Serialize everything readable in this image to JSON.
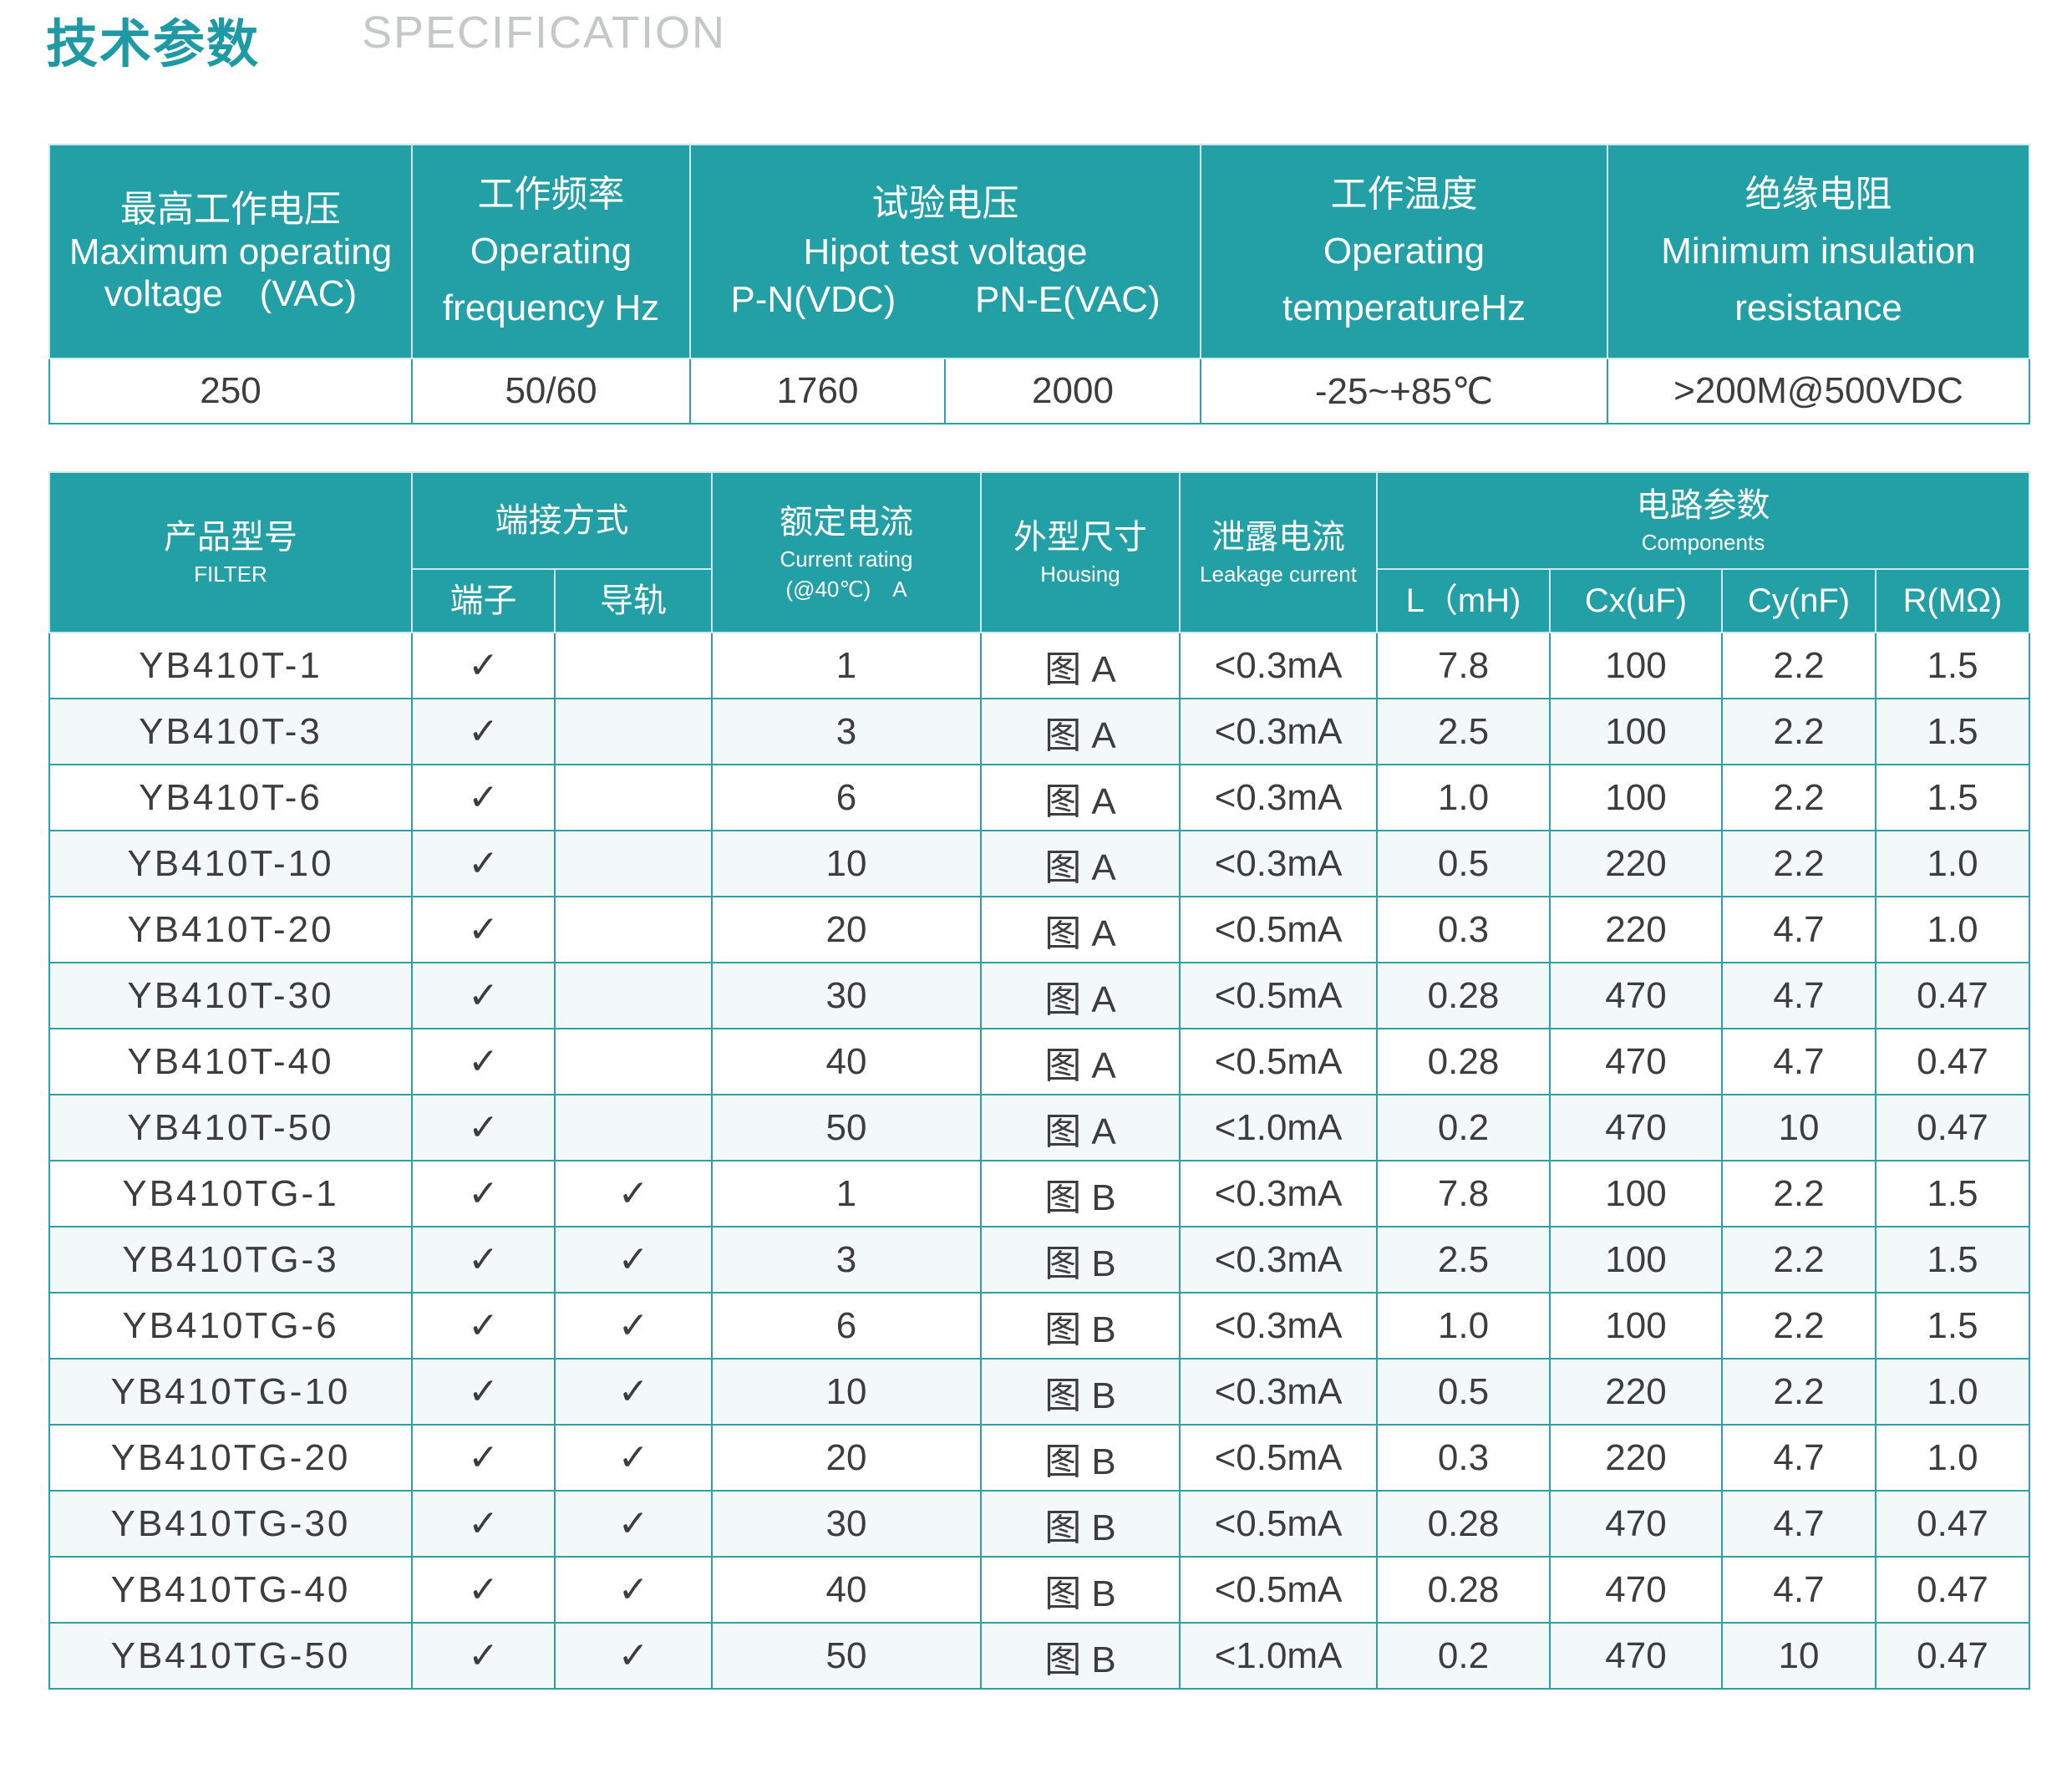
{
  "header": {
    "title_cn": "技术参数",
    "title_en": "SPECIFICATION"
  },
  "spec": {
    "headers": {
      "max_voltage_cn": "最高工作电压",
      "max_voltage_en": "Maximum operating",
      "max_voltage_en2": "voltage　(VAC)",
      "freq_cn": "工作频率",
      "freq_en": "Operating",
      "freq_en2": "frequency Hz",
      "hipot_cn": "试验电压",
      "hipot_en": "Hipot test voltage",
      "hipot_pn": "P-N(VDC)",
      "hipot_pne": "PN-E(VAC)",
      "temp_cn": "工作温度",
      "temp_en": "Operating",
      "temp_en2": "temperatureHz",
      "ins_cn": "绝缘电阻",
      "ins_en": "Minimum insulation",
      "ins_en2": "resistance"
    },
    "values": [
      "250",
      "50/60",
      "1760",
      "2000",
      "-25~+85℃",
      ">200M@500VDC"
    ]
  },
  "models": {
    "headers": {
      "product_cn": "产品型号",
      "product_en": "FILTER",
      "term_cn": "端接方式",
      "terminal": "端子",
      "rail": "导轨",
      "current_cn": "额定电流",
      "current_en": "Current rating",
      "current_unit": "(@40℃)　A",
      "housing_cn": "外型尺寸",
      "housing_en": "Housing",
      "leak_cn": "泄露电流",
      "leak_en": "Leakage current",
      "circuit_cn": "电路参数",
      "circuit_en": "Components",
      "l": "L（mH)",
      "cx": "Cx(uF)",
      "cy": "Cy(nF)",
      "r": "R(MΩ)"
    },
    "rows": [
      {
        "model": "YB410T-1",
        "terminal": "✓",
        "rail": "",
        "current": "1",
        "housing": "图 A",
        "leak": "<0.3mA",
        "l": "7.8",
        "cx": "100",
        "cy": "2.2",
        "r": "1.5"
      },
      {
        "model": "YB410T-3",
        "terminal": "✓",
        "rail": "",
        "current": "3",
        "housing": "图 A",
        "leak": "<0.3mA",
        "l": "2.5",
        "cx": "100",
        "cy": "2.2",
        "r": "1.5"
      },
      {
        "model": "YB410T-6",
        "terminal": "✓",
        "rail": "",
        "current": "6",
        "housing": "图 A",
        "leak": "<0.3mA",
        "l": "1.0",
        "cx": "100",
        "cy": "2.2",
        "r": "1.5"
      },
      {
        "model": "YB410T-10",
        "terminal": "✓",
        "rail": "",
        "current": "10",
        "housing": "图 A",
        "leak": "<0.3mA",
        "l": "0.5",
        "cx": "220",
        "cy": "2.2",
        "r": "1.0"
      },
      {
        "model": "YB410T-20",
        "terminal": "✓",
        "rail": "",
        "current": "20",
        "housing": "图 A",
        "leak": "<0.5mA",
        "l": "0.3",
        "cx": "220",
        "cy": "4.7",
        "r": "1.0"
      },
      {
        "model": "YB410T-30",
        "terminal": "✓",
        "rail": "",
        "current": "30",
        "housing": "图 A",
        "leak": "<0.5mA",
        "l": "0.28",
        "cx": "470",
        "cy": "4.7",
        "r": "0.47"
      },
      {
        "model": "YB410T-40",
        "terminal": "✓",
        "rail": "",
        "current": "40",
        "housing": "图 A",
        "leak": "<0.5mA",
        "l": "0.28",
        "cx": "470",
        "cy": "4.7",
        "r": "0.47"
      },
      {
        "model": "YB410T-50",
        "terminal": "✓",
        "rail": "",
        "current": "50",
        "housing": "图 A",
        "leak": "<1.0mA",
        "l": "0.2",
        "cx": "470",
        "cy": "10",
        "r": "0.47"
      },
      {
        "model": "YB410TG-1",
        "terminal": "✓",
        "rail": "✓",
        "current": "1",
        "housing": "图 B",
        "leak": "<0.3mA",
        "l": "7.8",
        "cx": "100",
        "cy": "2.2",
        "r": "1.5"
      },
      {
        "model": "YB410TG-3",
        "terminal": "✓",
        "rail": "✓",
        "current": "3",
        "housing": "图 B",
        "leak": "<0.3mA",
        "l": "2.5",
        "cx": "100",
        "cy": "2.2",
        "r": "1.5"
      },
      {
        "model": "YB410TG-6",
        "terminal": "✓",
        "rail": "✓",
        "current": "6",
        "housing": "图 B",
        "leak": "<0.3mA",
        "l": "1.0",
        "cx": "100",
        "cy": "2.2",
        "r": "1.5"
      },
      {
        "model": "YB410TG-10",
        "terminal": "✓",
        "rail": "✓",
        "current": "10",
        "housing": "图 B",
        "leak": "<0.3mA",
        "l": "0.5",
        "cx": "220",
        "cy": "2.2",
        "r": "1.0"
      },
      {
        "model": "YB410TG-20",
        "terminal": "✓",
        "rail": "✓",
        "current": "20",
        "housing": "图 B",
        "leak": "<0.5mA",
        "l": "0.3",
        "cx": "220",
        "cy": "4.7",
        "r": "1.0"
      },
      {
        "model": "YB410TG-30",
        "terminal": "✓",
        "rail": "✓",
        "current": "30",
        "housing": "图 B",
        "leak": "<0.5mA",
        "l": "0.28",
        "cx": "470",
        "cy": "4.7",
        "r": "0.47"
      },
      {
        "model": "YB410TG-40",
        "terminal": "✓",
        "rail": "✓",
        "current": "40",
        "housing": "图 B",
        "leak": "<0.5mA",
        "l": "0.28",
        "cx": "470",
        "cy": "4.7",
        "r": "0.47"
      },
      {
        "model": "YB410TG-50",
        "terminal": "✓",
        "rail": "✓",
        "current": "50",
        "housing": "图 B",
        "leak": "<1.0mA",
        "l": "0.2",
        "cx": "470",
        "cy": "10",
        "r": "0.47"
      }
    ]
  }
}
